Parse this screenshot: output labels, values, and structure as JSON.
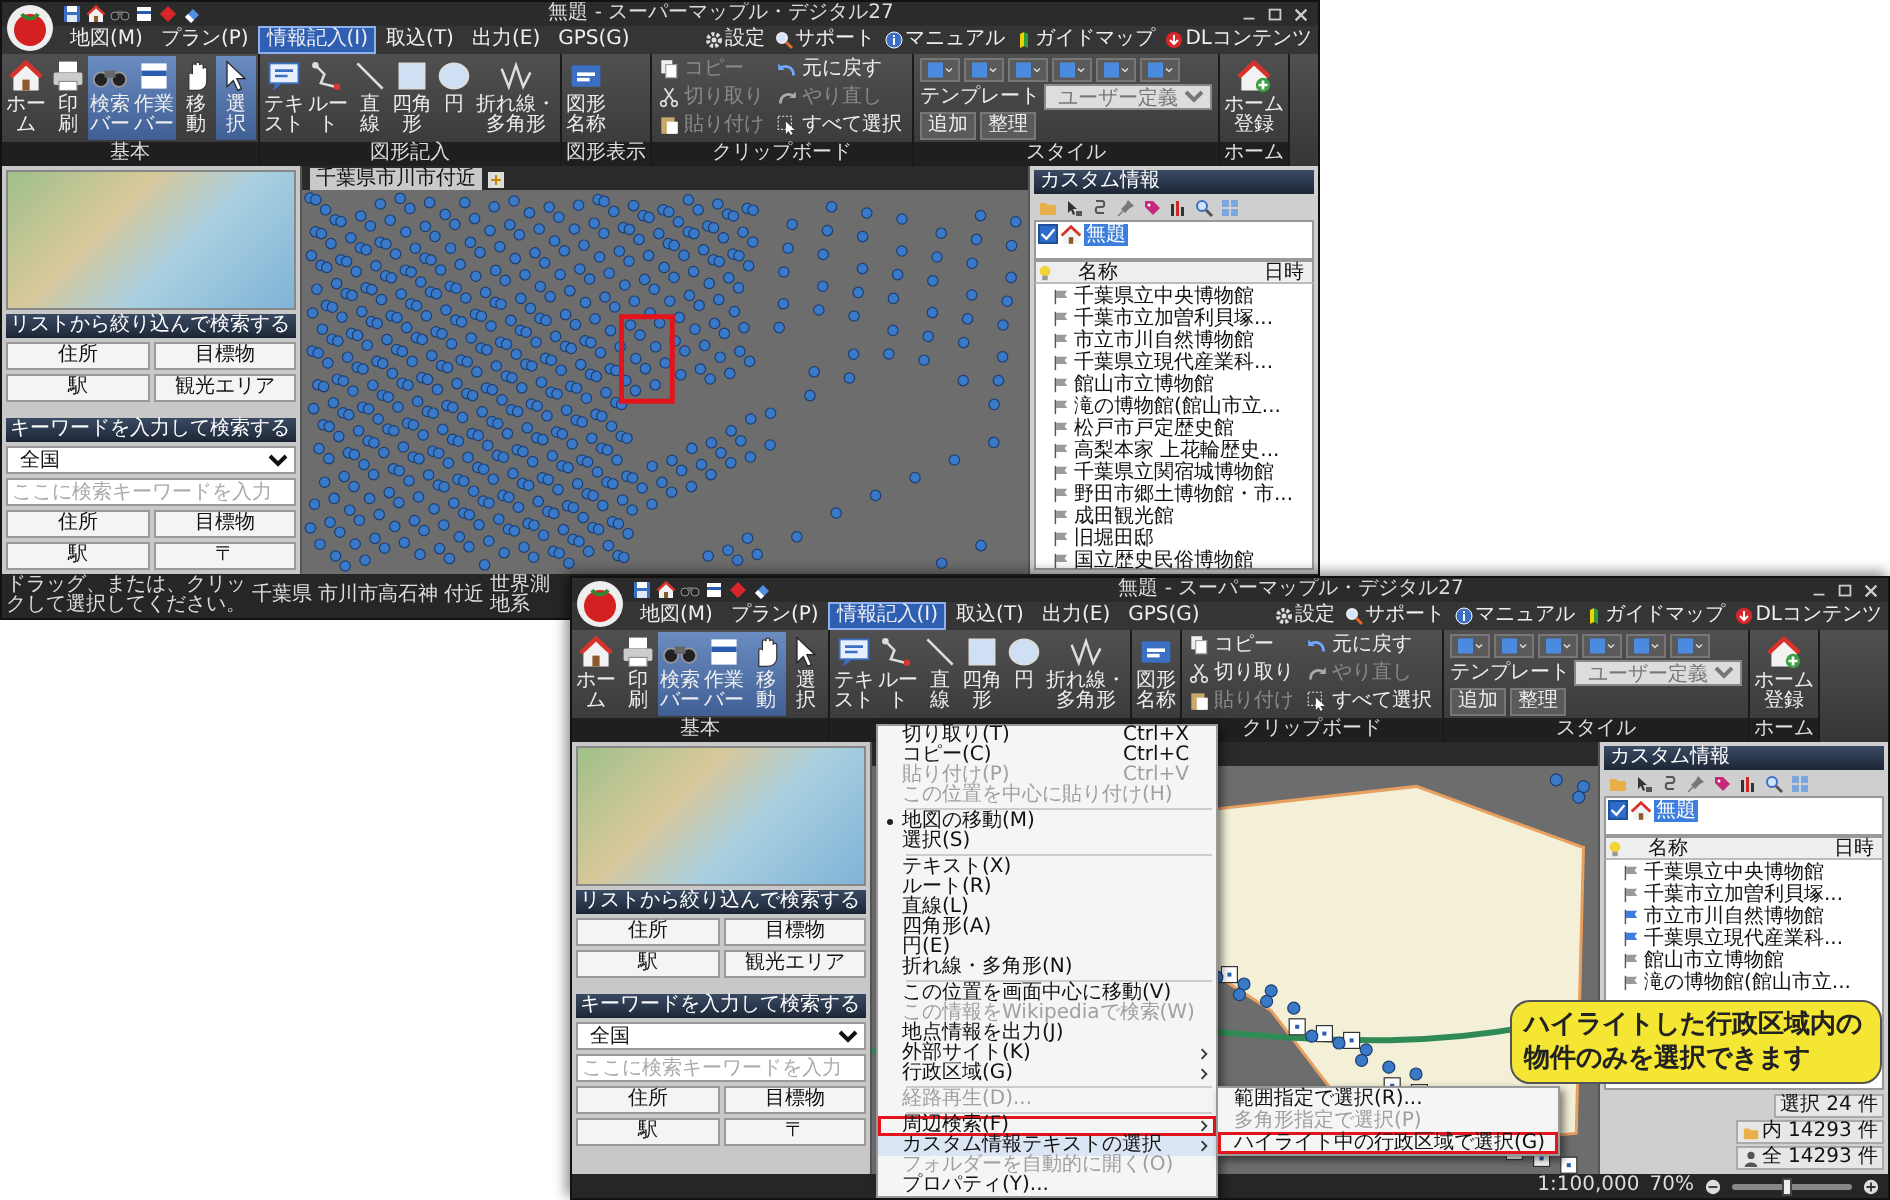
{
  "windows": [
    {
      "title": "無題 - スーパーマップル・デジタル27",
      "menu_tabs": [
        {
          "label": "地図(M)",
          "selected": false
        },
        {
          "label": "プラン(P)",
          "selected": false
        },
        {
          "label": "情報記入(I)",
          "selected": true
        },
        {
          "label": "取込(T)",
          "selected": false
        },
        {
          "label": "出力(E)",
          "selected": false
        },
        {
          "label": "GPS(G)",
          "selected": false
        }
      ],
      "top_links": [
        "設定",
        "サポート",
        "マニュアル",
        "ガイドマップ",
        "DLコンテンツ"
      ],
      "ribbon": [
        {
          "label": "基本",
          "kind": "large",
          "items": [
            {
              "label": "ホーム",
              "active": false
            },
            {
              "label": "印刷",
              "active": false
            },
            {
              "label": "検索バー",
              "active": true
            },
            {
              "label": "作業バー",
              "active": true
            },
            {
              "label": "移動",
              "active": false
            },
            {
              "label": "選択",
              "active": true
            }
          ]
        },
        {
          "label": "図形記入",
          "kind": "large",
          "items": [
            {
              "label": "テキスト",
              "active": false
            },
            {
              "label": "ルート",
              "active": false
            },
            {
              "label": "直線",
              "active": false
            },
            {
              "label": "四角形",
              "active": false
            },
            {
              "label": "円",
              "active": false
            },
            {
              "label": "折れ線・多角形",
              "active": false
            }
          ]
        },
        {
          "label": "図形表示",
          "kind": "large",
          "items": [
            {
              "label": "図形名称",
              "active": false
            }
          ]
        },
        {
          "label": "クリップボード",
          "kind": "small",
          "items": [
            {
              "label": "コピー",
              "disabled": true
            },
            {
              "label": "切り取り",
              "disabled": true
            },
            {
              "label": "貼り付け",
              "disabled": true
            },
            {
              "label": "元に戻す",
              "disabled": false
            },
            {
              "label": "やり直し",
              "disabled": true
            },
            {
              "label": "すべて選択",
              "disabled": false
            }
          ]
        },
        {
          "label": "スタイル",
          "kind": "style",
          "template_label": "テンプレート",
          "template_value": "ユーザー定義",
          "buttons": [
            "追加",
            "整理"
          ]
        },
        {
          "label": "ホーム",
          "kind": "large",
          "items": [
            {
              "label": "ホーム登録",
              "active": false
            }
          ]
        }
      ],
      "left_panel": {
        "list_search": {
          "header": "リストから絞り込んで検索する",
          "buttons": [
            "住所",
            "目標物",
            "駅",
            "観光エリア"
          ]
        },
        "keyword_search": {
          "header": "キーワードを入力して検索する",
          "region": "全国",
          "placeholder": "ここに検索キーワードを入力",
          "buttons": [
            "住所",
            "目標物",
            "駅",
            "〒"
          ]
        }
      },
      "map": {
        "tab": "千葉県市川市付近",
        "kind": "markers",
        "highlight_frame": true
      },
      "right_panel": {
        "header": "カスタム情報",
        "tree": [
          {
            "label": "無題",
            "checked": true,
            "selected": true
          }
        ],
        "columns": [
          "名称",
          "日時"
        ],
        "rows": [
          {
            "name": "千葉県立中央博物館",
            "selected": false
          },
          {
            "name": "千葉市立加曽利貝塚...",
            "selected": false
          },
          {
            "name": "市立市川自然博物館",
            "selected": false
          },
          {
            "name": "千葉県立現代産業科...",
            "selected": false
          },
          {
            "name": "館山市立博物館",
            "selected": false
          },
          {
            "name": "滝の博物館(館山市立...",
            "selected": false
          },
          {
            "name": "松戸市戸定歴史館",
            "selected": false
          },
          {
            "name": "高梨本家 上花輪歴史...",
            "selected": false
          },
          {
            "name": "千葉県立関宿城博物館",
            "selected": false
          },
          {
            "name": "野田市郷土博物館・市...",
            "selected": false
          },
          {
            "name": "成田観光館",
            "selected": false
          },
          {
            "name": "旧堀田邸",
            "selected": false
          },
          {
            "name": "国立歴史民俗博物館",
            "selected": false
          }
        ]
      },
      "status_bar": {
        "texts": [
          "ドラッグ、または、クリックして選択してください。",
          "千葉県",
          "市川市高石神 付近",
          "世界測地系"
        ]
      }
    },
    {
      "title": "無題 - スーパーマップル・デジタル27",
      "menu_tabs": [
        {
          "label": "地図(M)",
          "selected": false
        },
        {
          "label": "プラン(P)",
          "selected": false
        },
        {
          "label": "情報記入(I)",
          "selected": true
        },
        {
          "label": "取込(T)",
          "selected": false
        },
        {
          "label": "出力(E)",
          "selected": false
        },
        {
          "label": "GPS(G)",
          "selected": false
        }
      ],
      "top_links": [
        "設定",
        "サポート",
        "マニュアル",
        "ガイドマップ",
        "DLコンテンツ"
      ],
      "ribbon": [
        {
          "label": "基本",
          "kind": "large",
          "items": [
            {
              "label": "ホーム",
              "active": false
            },
            {
              "label": "印刷",
              "active": false
            },
            {
              "label": "検索バー",
              "active": true
            },
            {
              "label": "作業バー",
              "active": true
            },
            {
              "label": "移動",
              "active": true
            },
            {
              "label": "選択",
              "active": false
            }
          ]
        },
        {
          "kind": "large",
          "items": [
            {
              "label": "テキスト",
              "active": false
            },
            {
              "label": "ルート",
              "active": false
            },
            {
              "label": "直線",
              "active": false
            },
            {
              "label": "四角形",
              "active": false
            },
            {
              "label": "円",
              "active": false
            },
            {
              "label": "折れ線・多角形",
              "active": false
            }
          ]
        },
        {
          "kind": "large",
          "items": [
            {
              "label": "図形名称",
              "active": false
            }
          ]
        },
        {
          "label": "クリップボード",
          "kind": "small",
          "items": [
            {
              "label": "コピー",
              "disabled": false
            },
            {
              "label": "切り取り",
              "disabled": false
            },
            {
              "label": "貼り付け",
              "disabled": true
            },
            {
              "label": "元に戻す",
              "disabled": false
            },
            {
              "label": "やり直し",
              "disabled": true
            },
            {
              "label": "すべて選択",
              "disabled": false
            }
          ]
        },
        {
          "label": "スタイル",
          "kind": "style",
          "template_label": "テンプレート",
          "template_value": "ユーザー定義",
          "buttons": [
            "追加",
            "整理"
          ]
        },
        {
          "label": "ホーム",
          "kind": "large",
          "items": [
            {
              "label": "ホーム登録",
              "active": false
            }
          ]
        }
      ],
      "left_panel": {
        "list_search": {
          "header": "リストから絞り込んで検索する",
          "buttons": [
            "住所",
            "目標物",
            "駅",
            "観光エリア"
          ]
        },
        "keyword_search": {
          "header": "キーワードを入力して検索する",
          "region": "全国",
          "placeholder": "ここに検索キーワードを入力",
          "buttons": [
            "住所",
            "目標物",
            "駅",
            "〒"
          ]
        }
      },
      "map": {
        "kind": "region",
        "highlight_frame": false
      },
      "right_panel": {
        "header": "カスタム情報",
        "tree": [
          {
            "label": "無題",
            "checked": true,
            "selected": true
          }
        ],
        "columns": [
          "名称",
          "日時"
        ],
        "rows": [
          {
            "name": "千葉県立中央博物館",
            "selected": false
          },
          {
            "name": "千葉市立加曽利貝塚...",
            "selected": false
          },
          {
            "name": "市立市川自然博物館",
            "selected": true
          },
          {
            "name": "千葉県立現代産業科...",
            "selected": true
          },
          {
            "name": "館山市立博物館",
            "selected": false
          },
          {
            "name": "滝の博物館(館山市立...",
            "selected": false
          }
        ],
        "footer": [
          "選択 24 件",
          "内 14293 件",
          "全 14293 件"
        ]
      },
      "status_bar": {
        "texts": [
          "1:100,000",
          "70%"
        ],
        "zoom": {
          "level": 0.45
        }
      },
      "context_menu": {
        "items": [
          {
            "kind": "item",
            "label": "切り取り(T)",
            "shortcut": "Ctrl+X",
            "disabled": false,
            "checked": false,
            "submenu": false,
            "selected": false,
            "annotated": false
          },
          {
            "kind": "item",
            "label": "コピー(C)",
            "shortcut": "Ctrl+C",
            "disabled": false,
            "checked": false,
            "submenu": false,
            "selected": false,
            "annotated": false
          },
          {
            "kind": "item",
            "label": "貼り付け(P)",
            "shortcut": "Ctrl+V",
            "disabled": true,
            "checked": false,
            "submenu": false,
            "selected": false,
            "annotated": false
          },
          {
            "kind": "item",
            "label": "この位置を中心に貼り付け(H)",
            "disabled": true,
            "checked": false,
            "submenu": false,
            "selected": false,
            "annotated": false
          },
          {
            "kind": "separator"
          },
          {
            "kind": "item",
            "label": "地図の移動(M)",
            "disabled": false,
            "checked": true,
            "submenu": false,
            "selected": false,
            "annotated": false
          },
          {
            "kind": "item",
            "label": "選択(S)",
            "disabled": false,
            "checked": false,
            "submenu": false,
            "selected": false,
            "annotated": false
          },
          {
            "kind": "separator"
          },
          {
            "kind": "item",
            "label": "テキスト(X)",
            "disabled": false,
            "checked": false,
            "submenu": false,
            "selected": false,
            "annotated": false
          },
          {
            "kind": "item",
            "label": "ルート(R)",
            "disabled": false,
            "checked": false,
            "submenu": false,
            "selected": false,
            "annotated": false
          },
          {
            "kind": "item",
            "label": "直線(L)",
            "disabled": false,
            "checked": false,
            "submenu": false,
            "selected": false,
            "annotated": false
          },
          {
            "kind": "item",
            "label": "四角形(A)",
            "disabled": false,
            "checked": false,
            "submenu": false,
            "selected": false,
            "annotated": false
          },
          {
            "kind": "item",
            "label": "円(E)",
            "disabled": false,
            "checked": false,
            "submenu": false,
            "selected": false,
            "annotated": false
          },
          {
            "kind": "item",
            "label": "折れ線・多角形(N)",
            "disabled": false,
            "checked": false,
            "submenu": false,
            "selected": false,
            "annotated": false
          },
          {
            "kind": "separator"
          },
          {
            "kind": "item",
            "label": "この位置を画面中心に移動(V)",
            "disabled": false,
            "checked": false,
            "submenu": false,
            "selected": false,
            "annotated": false
          },
          {
            "kind": "item",
            "label": "この情報をWikipediaで検索(W)",
            "disabled": true,
            "checked": false,
            "submenu": false,
            "selected": false,
            "annotated": false
          },
          {
            "kind": "item",
            "label": "地点情報を出力(J)",
            "disabled": false,
            "checked": false,
            "submenu": false,
            "selected": false,
            "annotated": false
          },
          {
            "kind": "item",
            "label": "外部サイト(K)",
            "disabled": false,
            "checked": false,
            "submenu": true,
            "selected": false,
            "annotated": false
          },
          {
            "kind": "item",
            "label": "行政区域(G)",
            "disabled": false,
            "checked": false,
            "submenu": true,
            "selected": false,
            "annotated": false
          },
          {
            "kind": "separator"
          },
          {
            "kind": "item",
            "label": "経路再生(D)...",
            "disabled": true,
            "checked": false,
            "submenu": false,
            "selected": false,
            "annotated": false
          },
          {
            "kind": "separator"
          },
          {
            "kind": "item",
            "label": "周辺検索(F)",
            "disabled": false,
            "checked": false,
            "submenu": true,
            "selected": false,
            "annotated": true
          },
          {
            "kind": "item",
            "label": "カスタム情報テキストの選択",
            "disabled": false,
            "checked": false,
            "submenu": true,
            "selected": true,
            "annotated": false,
            "submenu_items": [
              {
                "label": "範囲指定で選択(R)...",
                "disabled": false,
                "annotated": false
              },
              {
                "label": "多角形指定で選択(P)",
                "disabled": true,
                "annotated": false
              },
              {
                "label": "ハイライト中の行政区域で選択(G)",
                "disabled": false,
                "annotated": true
              }
            ]
          },
          {
            "kind": "item",
            "label": "フォルダーを自動的に開く(O)",
            "disabled": true,
            "checked": false,
            "submenu": false,
            "selected": false,
            "annotated": false
          },
          {
            "kind": "item",
            "label": "プロパティ(Y)...",
            "disabled": false,
            "checked": false,
            "submenu": false,
            "selected": false,
            "annotated": false
          }
        ]
      }
    }
  ],
  "callout": {
    "lines": [
      "ハイライトした行政区域内の",
      "物件のみを選択できます"
    ]
  }
}
